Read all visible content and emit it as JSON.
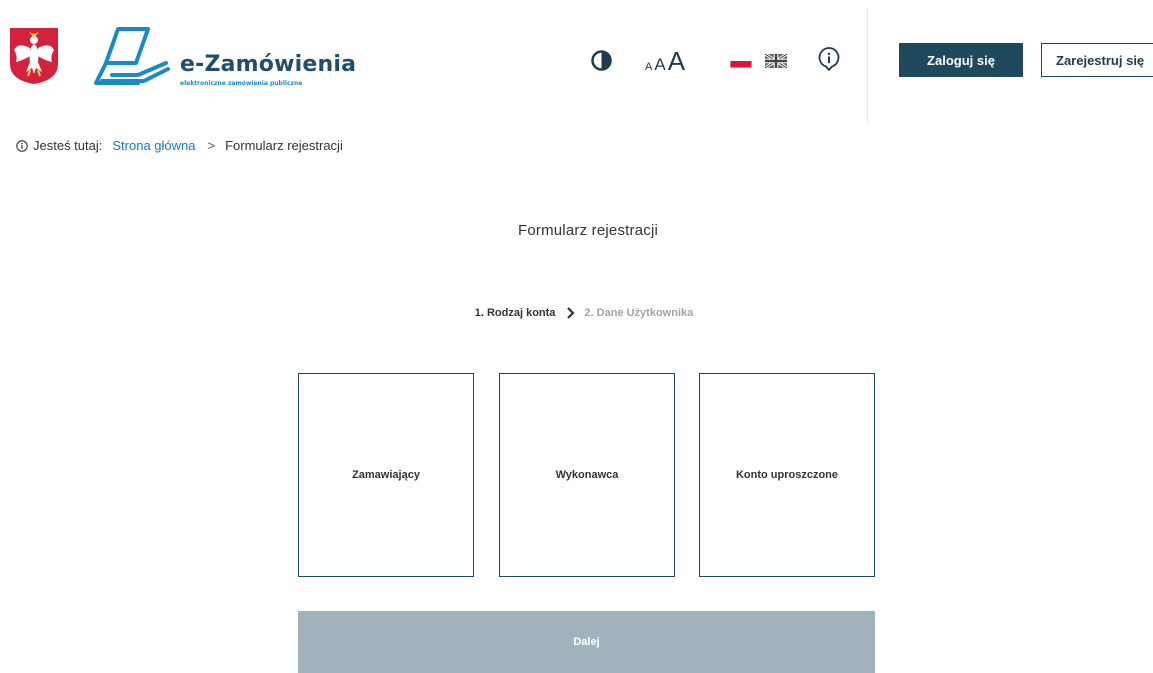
{
  "header": {
    "emblem_icon": "polish-eagle-emblem-icon",
    "logo": {
      "title": "e-Zamówienia",
      "subtitle": "elektroniczne zamówienia publiczne",
      "icon": "laptop-logo-icon",
      "brand_color": "#1a8ac6"
    },
    "tools": {
      "contrast_icon": "contrast-icon",
      "font_small": "A",
      "font_medium": "A",
      "font_large": "A",
      "flag_pl_icon": "poland-flag-icon",
      "flag_en_icon": "uk-flag-icon",
      "info_icon": "info-icon"
    },
    "login_label": "Zaloguj się",
    "register_label": "Zarejestruj się",
    "primary_color": "#1f4a5e"
  },
  "breadcrumb": {
    "icon": "info-icon",
    "label": "Jesteś tutaj:",
    "items": [
      {
        "label": "Strona główna",
        "link": true
      },
      {
        "label": "Formularz rejestracji",
        "link": false
      }
    ],
    "separator": ">"
  },
  "form": {
    "title": "Formularz rejestracji",
    "steps": [
      {
        "label": "1. Rodzaj konta",
        "active": true
      },
      {
        "label": "2. Dane Użytkownika",
        "active": false
      }
    ],
    "account_types": [
      {
        "label": "Zamawiający"
      },
      {
        "label": "Wykonawca"
      },
      {
        "label": "Konto uproszczone"
      }
    ],
    "next_label": "Dalej",
    "next_disabled_color": "#a0b3bd"
  }
}
